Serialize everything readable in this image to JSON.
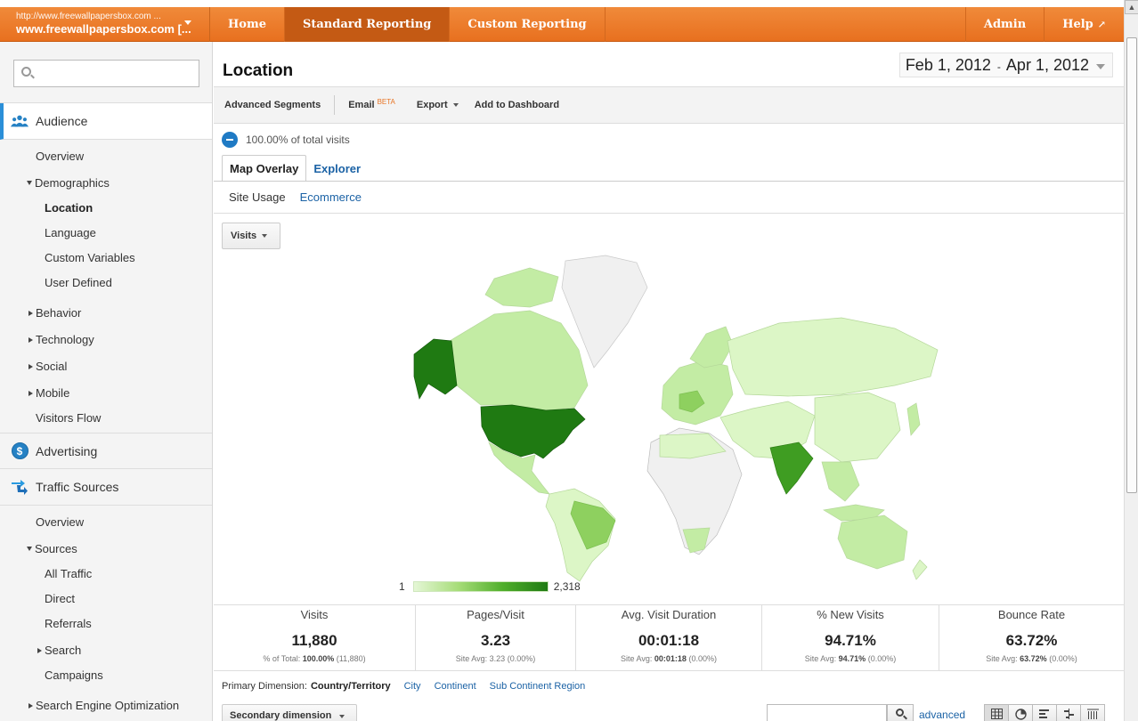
{
  "account": {
    "url": "http://www.freewallpapersbox.com ...",
    "name": "www.freewallpapersbox.com [..."
  },
  "nav": {
    "home": "Home",
    "standard_reporting": "Standard Reporting",
    "custom_reporting": "Custom Reporting",
    "admin": "Admin",
    "help": "Help"
  },
  "sidebar": {
    "search_placeholder": "",
    "audience": "Audience",
    "overview": "Overview",
    "demographics": "Demographics",
    "location": "Location",
    "language": "Language",
    "custom_variables": "Custom Variables",
    "user_defined": "User Defined",
    "behavior": "Behavior",
    "technology": "Technology",
    "social": "Social",
    "mobile": "Mobile",
    "visitors_flow": "Visitors Flow",
    "advertising": "Advertising",
    "traffic_sources": "Traffic Sources",
    "ts_overview": "Overview",
    "sources": "Sources",
    "all_traffic": "All Traffic",
    "direct": "Direct",
    "referrals": "Referrals",
    "search": "Search",
    "campaigns": "Campaigns",
    "seo": "Search Engine Optimization"
  },
  "page": {
    "title": "Location",
    "date_start": "Feb 1, 2012",
    "date_sep": "-",
    "date_end": "Apr 1, 2012"
  },
  "toolbar": {
    "advanced_segments": "Advanced Segments",
    "email": "Email",
    "beta": "BETA",
    "export": "Export",
    "add_to_dashboard": "Add to Dashboard"
  },
  "segment": {
    "label": "100.00% of total visits"
  },
  "tabs": {
    "map_overlay": "Map Overlay",
    "explorer": "Explorer"
  },
  "subtabs": {
    "site_usage": "Site Usage",
    "ecommerce": "Ecommerce"
  },
  "metric": {
    "selected": "Visits"
  },
  "legend": {
    "min": "1",
    "max": "2,318"
  },
  "map_colors": {
    "darkest": "#1f7a12",
    "dark": "#3f9d22",
    "medium": "#8ed05f",
    "light": "#c3eca4",
    "lighter": "#dcf6c6",
    "no_data": "#f0f0f0"
  },
  "scorecards": [
    {
      "label": "Visits",
      "value": "11,880",
      "sub_prefix": "% of Total:",
      "sub_bold": "100.00%",
      "sub_suffix": "(11,880)"
    },
    {
      "label": "Pages/Visit",
      "value": "3.23",
      "sub_prefix": "Site Avg:",
      "sub_bold": "3.23",
      "sub_suffix": "(0.00%)"
    },
    {
      "label": "Avg. Visit Duration",
      "value": "00:01:18",
      "sub_prefix": "Site Avg:",
      "sub_bold": "00:01:18",
      "sub_suffix": "(0.00%)"
    },
    {
      "label": "% New Visits",
      "value": "94.71%",
      "sub_prefix": "Site Avg:",
      "sub_bold": "94.71%",
      "sub_suffix": "(0.00%)"
    },
    {
      "label": "Bounce Rate",
      "value": "63.72%",
      "sub_prefix": "Site Avg:",
      "sub_bold": "63.72%",
      "sub_suffix": "(0.00%)"
    }
  ],
  "dimensions": {
    "label": "Primary Dimension:",
    "current": "Country/Territory",
    "city": "City",
    "continent": "Continent",
    "sub_continent": "Sub Continent Region"
  },
  "secondary": {
    "label": "Secondary dimension"
  },
  "table_search": {
    "advanced": "advanced"
  }
}
